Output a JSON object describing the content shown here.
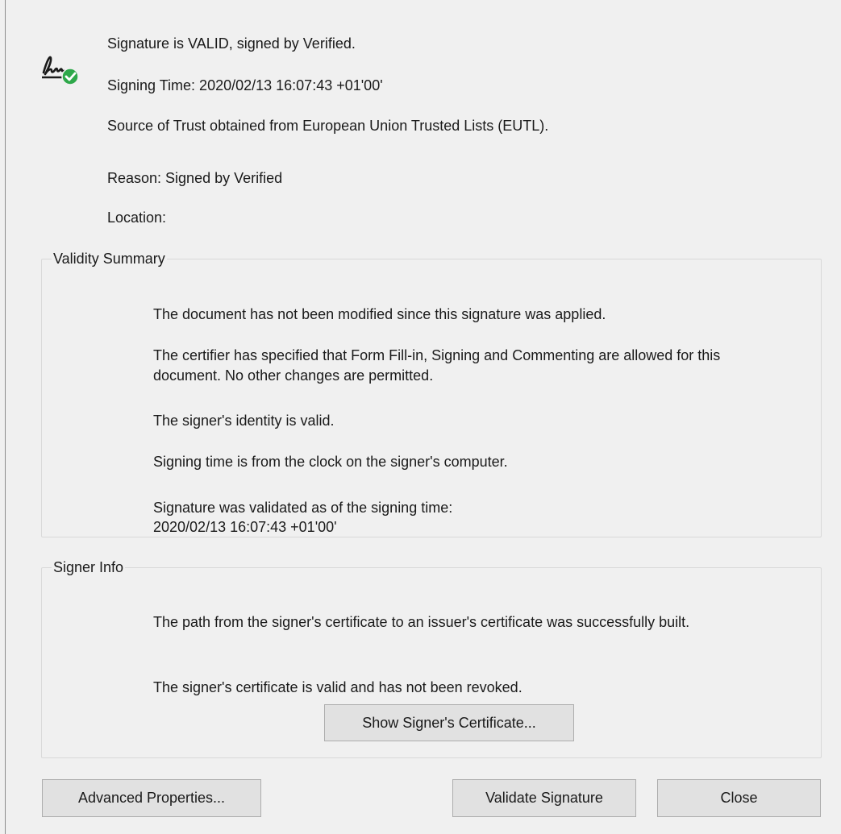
{
  "header": {
    "status": "Signature is VALID, signed by Verified.",
    "signing_time": "Signing Time:  2020/02/13 16:07:43 +01'00'",
    "trust_source": "Source of Trust obtained from European Union Trusted Lists (EUTL).",
    "reason": "Reason:  Signed by Verified",
    "location": "Location:"
  },
  "validity_summary": {
    "title": "Validity Summary",
    "items": [
      "The document has not been modified since this signature was applied.",
      "The certifier has specified that Form Fill-in, Signing and Commenting are allowed for this document. No other changes are permitted.",
      "The signer's identity is valid.",
      "Signing time is from the clock on the signer's computer.",
      "Signature was validated as of the signing time:"
    ],
    "validated_time": "2020/02/13 16:07:43 +01'00'"
  },
  "signer_info": {
    "title": "Signer Info",
    "items": [
      "The path from the signer's certificate to an issuer's certificate was successfully built.",
      "The signer's certificate is valid and has not been revoked."
    ],
    "show_certificate_label": "Show Signer's Certificate..."
  },
  "buttons": {
    "advanced_properties": "Advanced Properties...",
    "validate_signature": "Validate Signature",
    "close": "Close"
  },
  "icons": {
    "signature_icon": "signature-valid-icon"
  },
  "colors": {
    "background": "#f0f0f0",
    "valid_check": "#2ea84a",
    "button_face": "#e1e1e1"
  }
}
